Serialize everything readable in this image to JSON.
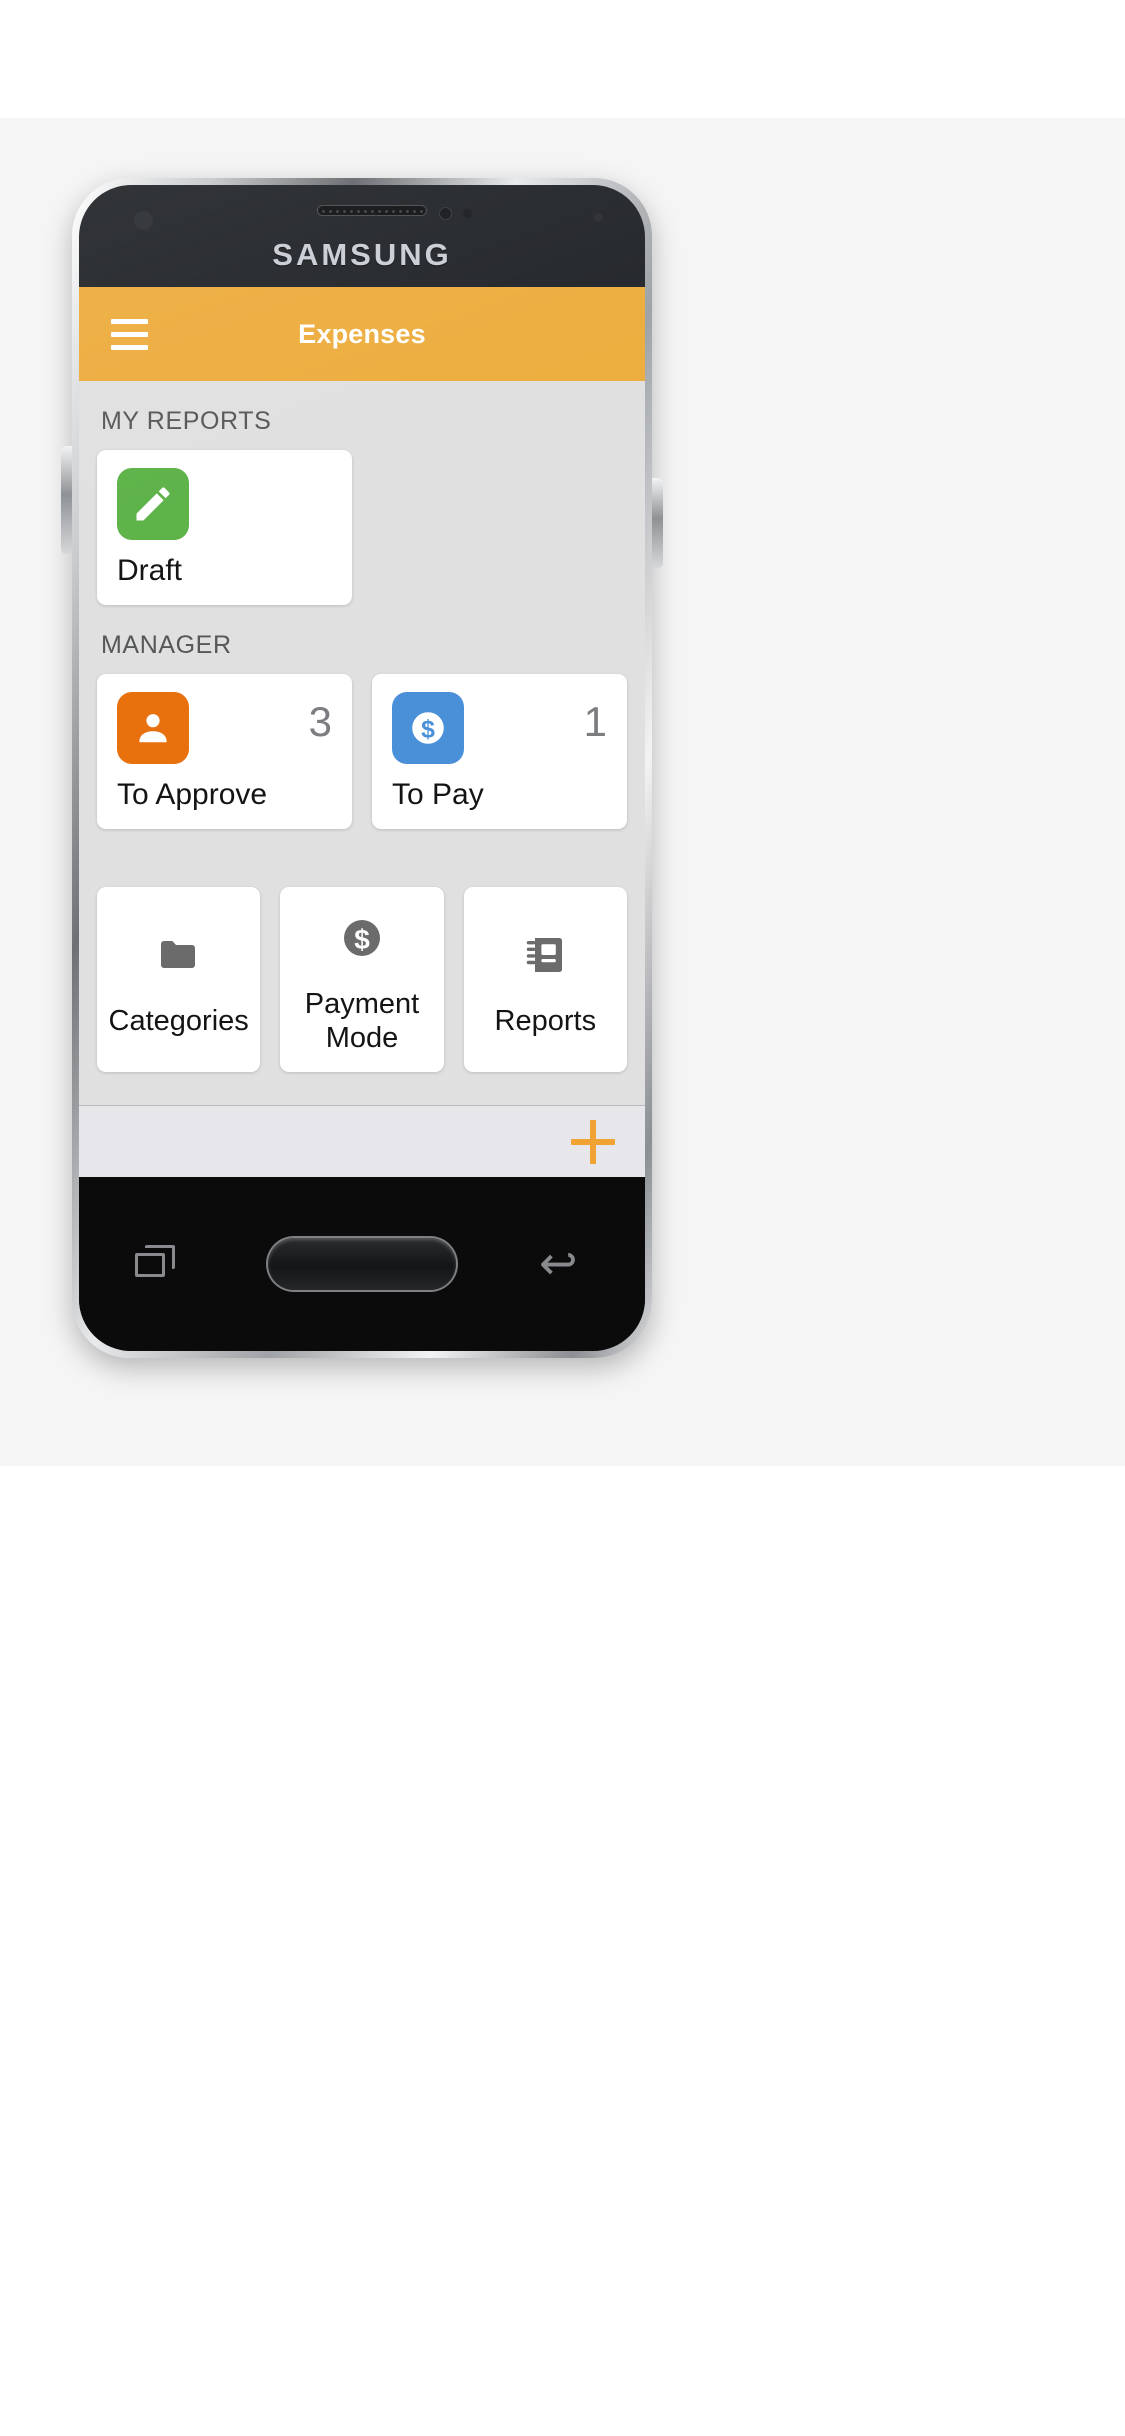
{
  "device": {
    "brand": "SAMSUNG"
  },
  "appbar": {
    "title": "Expenses",
    "menu_icon": "hamburger-menu-icon",
    "background": "#edad3e"
  },
  "sections": [
    {
      "label": "MY REPORTS",
      "tiles": [
        {
          "label": "Draft",
          "count": "",
          "icon": "pencil-edit-icon",
          "icon_color": "#5cb247"
        }
      ]
    },
    {
      "label": "MANAGER",
      "tiles": [
        {
          "label": "To Approve",
          "count": "3",
          "icon": "person-icon",
          "icon_color": "#e8700d"
        },
        {
          "label": "To Pay",
          "count": "1",
          "icon": "dollar-coin-icon",
          "icon_color": "#4a90d9"
        }
      ]
    }
  ],
  "shortcuts": [
    {
      "label": "Categories",
      "icon": "folder-icon",
      "icon_color": "#6b6b6b"
    },
    {
      "label": "Payment Mode",
      "icon": "dollar-coin-icon",
      "icon_color": "#6b6b6b"
    },
    {
      "label": "Reports",
      "icon": "notebook-icon",
      "icon_color": "#6b6b6b"
    }
  ],
  "actionbar": {
    "add_icon": "plus-icon",
    "add_color": "#f0a232"
  },
  "navbar": {
    "recents_icon": "recents-icon",
    "home_icon": "home-key",
    "back_icon": "back-icon"
  },
  "colors": {
    "accent": "#edad3e",
    "screen_bg": "#e0e0e0",
    "card_bg": "#ffffff",
    "page_bg": "#f5f5f5"
  }
}
